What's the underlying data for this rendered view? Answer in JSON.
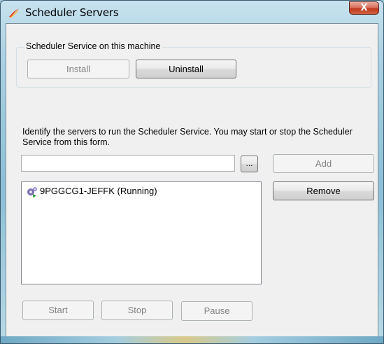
{
  "window": {
    "title": "Scheduler Servers",
    "close_label": "X"
  },
  "service_group": {
    "legend": "Scheduler Service on this machine",
    "install_label": "Install",
    "uninstall_label": "Uninstall"
  },
  "servers": {
    "description": "Identify the servers to run the Scheduler Service. You may start or stop the Scheduler Service from this form.",
    "input_value": "",
    "input_placeholder": "",
    "browse_label": "...",
    "add_label": "Add",
    "remove_label": "Remove",
    "items": [
      {
        "label": "9PGGCG1-JEFFK (Running)",
        "icon": "server-running-icon"
      }
    ]
  },
  "actions": {
    "start_label": "Start",
    "stop_label": "Stop",
    "pause_label": "Pause"
  },
  "colors": {
    "title_bar": "#a9d0e2",
    "client_bg": "#f0f0f0",
    "close_red": "#c0391f"
  }
}
